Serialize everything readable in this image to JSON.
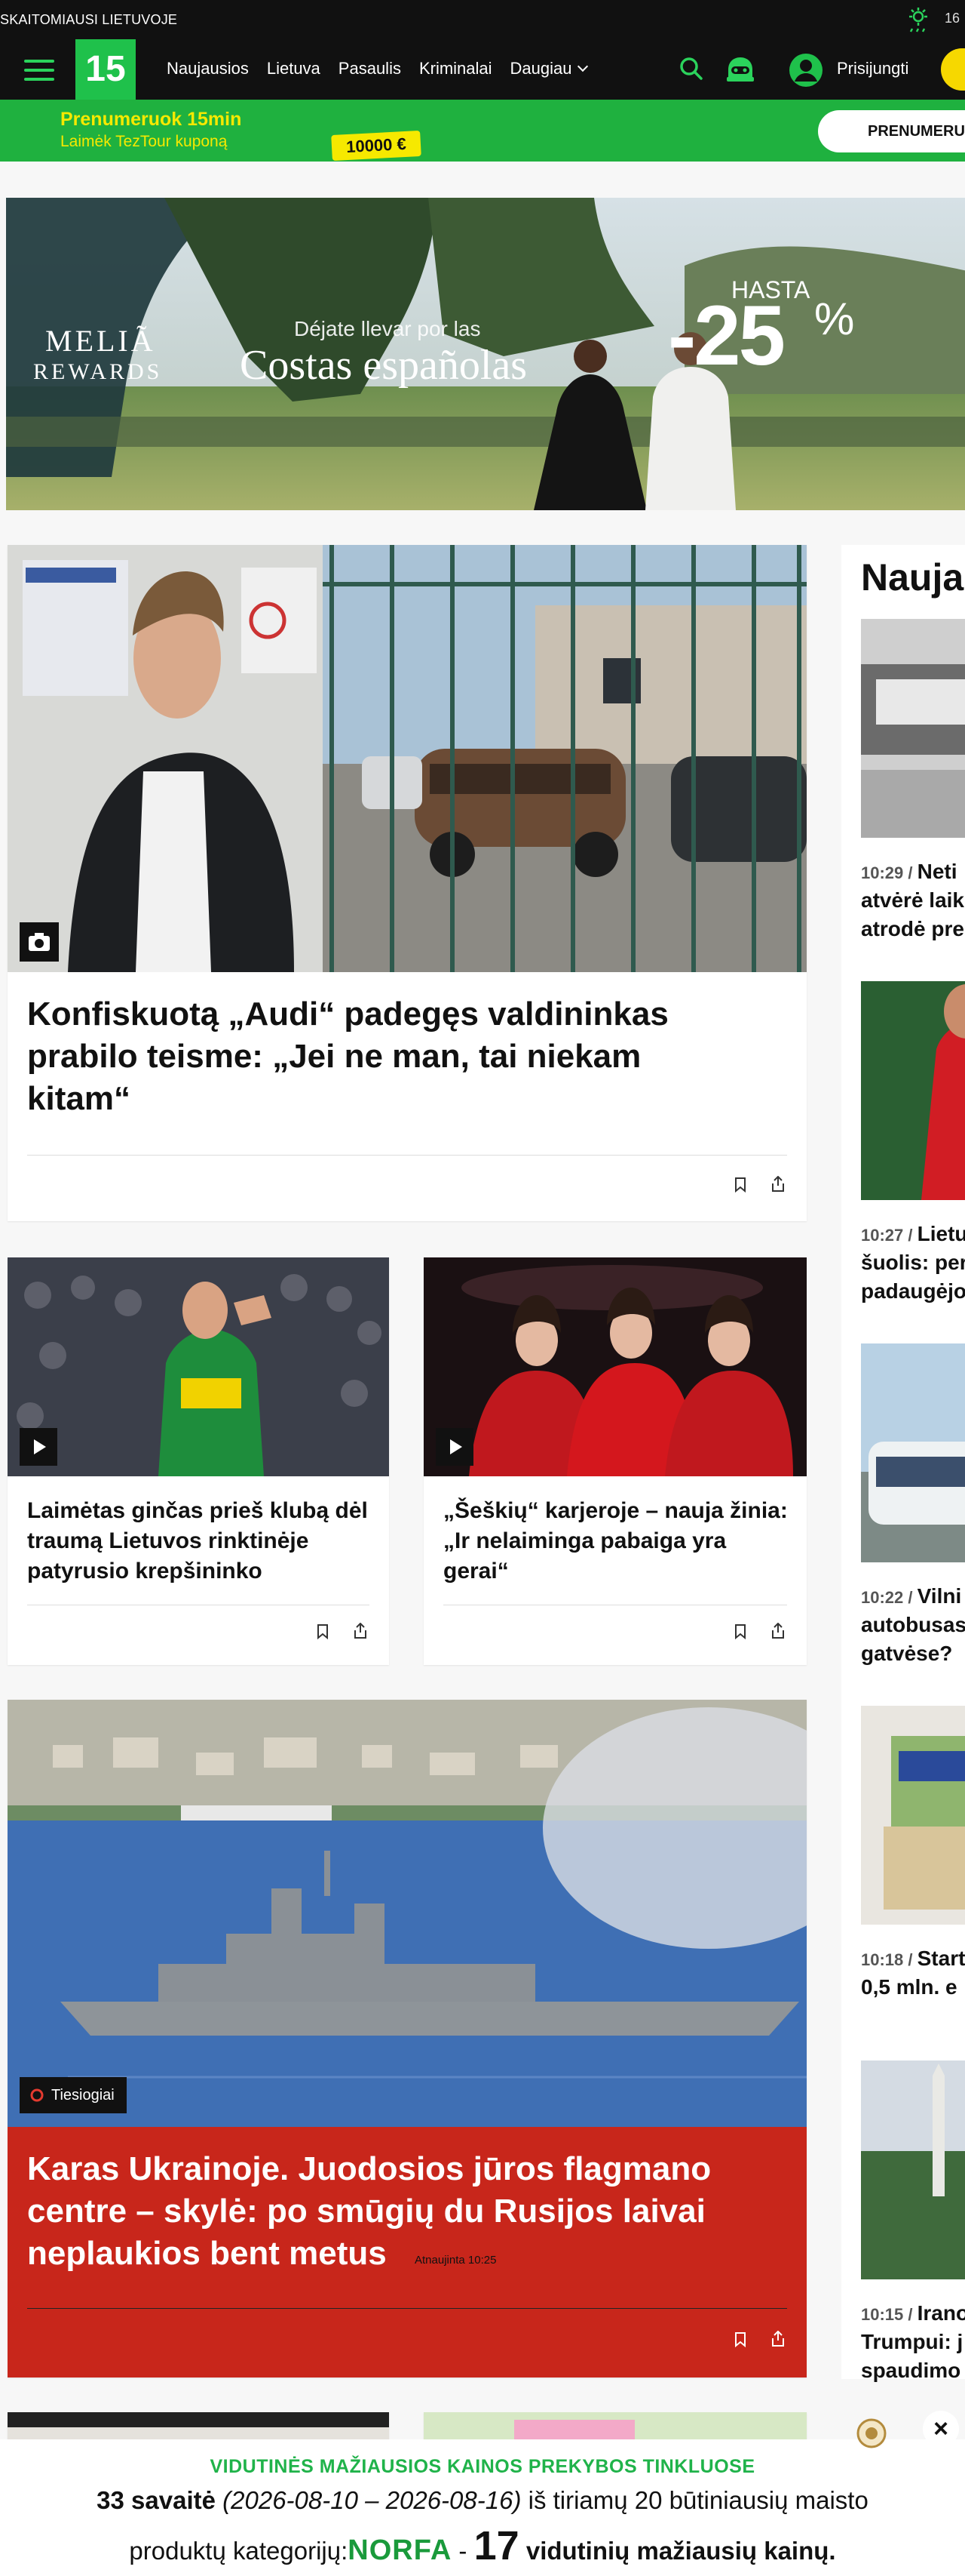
{
  "topbar": {
    "tagline": "SKAITOMIAUSI LIETUVOJE",
    "temperature": "16"
  },
  "nav": {
    "logo": "15",
    "links": [
      "Naujausios",
      "Lietuva",
      "Pasaulis",
      "Kriminalai"
    ],
    "more": "Daugiau",
    "login": "Prisijungti"
  },
  "promo": {
    "headline": "Prenumeruok 15min",
    "subline": "Laimėk TezTour kuponą",
    "coupon": "10000 €",
    "button": "PRENUMERUOK"
  },
  "ad": {
    "brand1": "MELIÃ",
    "brand2": "REWARDS",
    "line1": "Déjate llevar por las",
    "line2": "Costas españolas",
    "hasta": "HASTA",
    "discount": "-25",
    "percent": "%"
  },
  "articles": {
    "main": {
      "title_l1": "Konfiskuotą „Audi“ padegęs valdininkas",
      "title_l2": "prabilo teisme: „Jei ne man, tai niekam",
      "title_l3": "kitam“"
    },
    "left": {
      "l1": "Laimėtas ginčas prieš klubą dėl",
      "l2": "traumą Lietuvos rinktinėje",
      "l3": "patyrusio krepšininko"
    },
    "right": {
      "l1": "„Šeškių“ karjeroje – nauja žinia:",
      "l2": "„Ir nelaiminga pabaiga yra",
      "l3": "gerai“"
    },
    "war": {
      "badge": "Tiesiogiai",
      "l1": "Karas Ukrainoje. Juodosios jūros flagmano",
      "l2": "centre – skylė: po smūgių du Rusijos laivai",
      "l3": "neplaukios bent metus",
      "updated": "Atnaujinta 10:25"
    }
  },
  "sidebar": {
    "title": "Nauja",
    "items": [
      {
        "time": "10:29",
        "l1": "Neti",
        "l2": "atvėrė laik",
        "l3": "atrodė pre"
      },
      {
        "time": "10:27",
        "l1": "Lietu",
        "l2": "šuolis: per",
        "l3": "padaugėjo"
      },
      {
        "time": "10:22",
        "l1": "Vilni",
        "l2": "autobusas",
        "l3": "gatvėse?"
      },
      {
        "time": "10:18",
        "l1": "Start",
        "l2": "0,5 mln. e"
      },
      {
        "time": "10:15",
        "l1": "Irano",
        "l2": "Trumpui: j",
        "l3": "spaudimo"
      }
    ]
  },
  "bottom_banner": {
    "heading": "VIDUTINĖS MAŽIAUSIOS KAINOS PREKYBOS TINKLUOSE",
    "week": "33 savaitė",
    "dates": "(2026-08-10 – 2026-08-16)",
    "line1_rest": " iš tiriamų 20 būtiniausių maisto",
    "line2_a": "produktų kategorijų:",
    "brand": "NORFA",
    "dash": " - ",
    "count": "17",
    "line2_b": " vidutinių mažiausių kainų."
  }
}
